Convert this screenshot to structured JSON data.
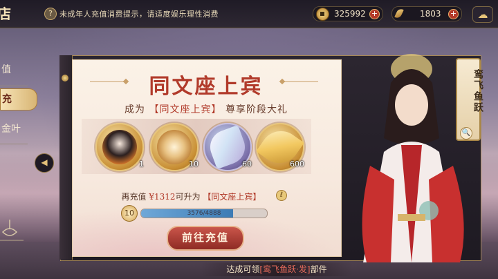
{
  "topbar": {
    "store_title": "店",
    "notice": "未成年人充值消费提示，请适度娱乐理性消费",
    "coins": "325992",
    "feathers": "1803"
  },
  "nav": {
    "items": [
      "值",
      "充",
      "金叶"
    ],
    "active_index": 1
  },
  "card": {
    "title": "同文座上宾",
    "subtitle_pre": "成为",
    "subtitle_rank": "【同文座上宾】",
    "subtitle_post": "尊享阶段大礼",
    "rewards": [
      {
        "name": "avatar-frame",
        "count": "1"
      },
      {
        "name": "pearl-ornament",
        "count": "10"
      },
      {
        "name": "crystal-leaf",
        "count": "60"
      },
      {
        "name": "golden-feather",
        "count": "600"
      }
    ],
    "recharge_pre": "再充值",
    "recharge_amount": "¥1312",
    "recharge_mid": "可升为",
    "recharge_rank": "【同文座上宾】",
    "vip_level": "10",
    "progress_text": "3576/4888",
    "progress_fraction": 0.73,
    "go_button": "前往充值"
  },
  "character": {
    "tag": "鸾飞鱼跃"
  },
  "footer": {
    "pre": "达成可领",
    "item": "[鸾飞鱼跃·发]",
    "post": "部件"
  },
  "colors": {
    "accent_red": "#b13a2a",
    "gold": "#c9a06a",
    "progress_blue": "#3b7bb5"
  }
}
